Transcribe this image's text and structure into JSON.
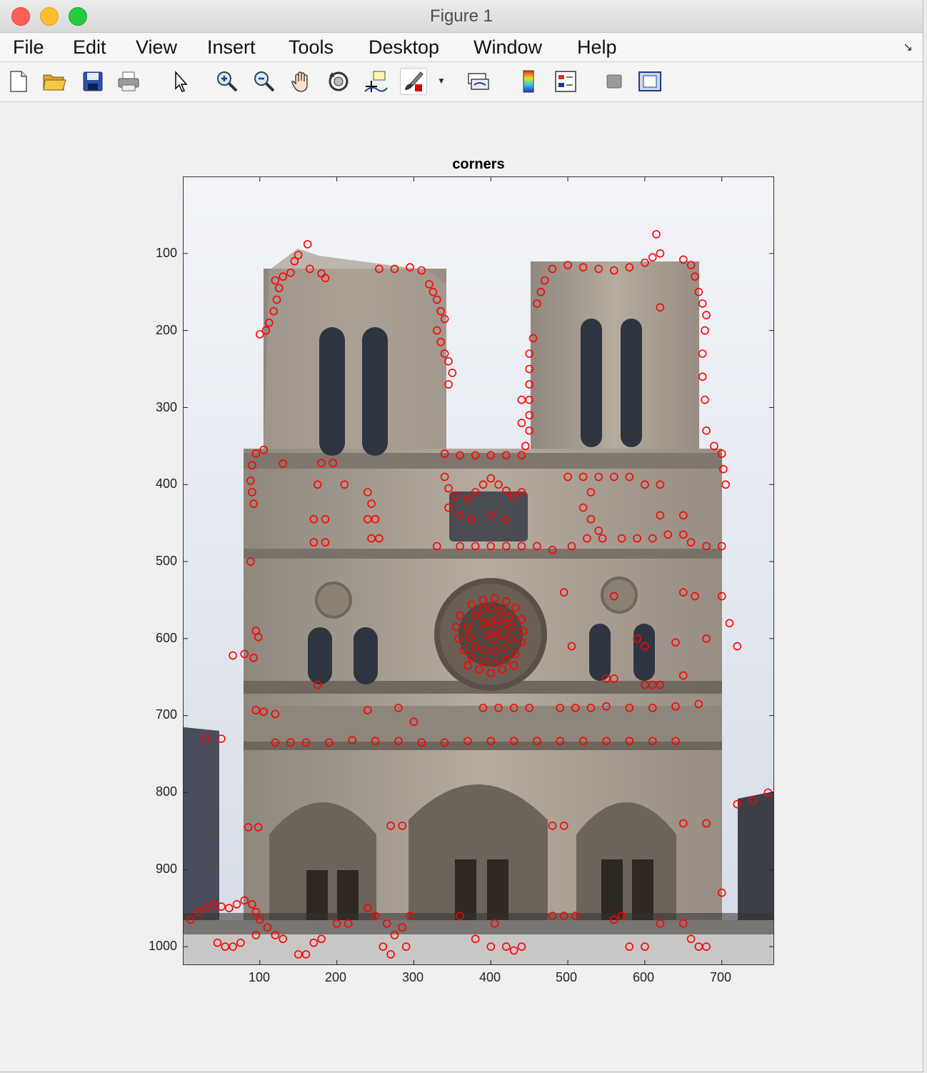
{
  "window": {
    "title": "Figure 1"
  },
  "menubar": {
    "items": [
      "File",
      "Edit",
      "View",
      "Insert",
      "Tools",
      "Desktop",
      "Window",
      "Help"
    ]
  },
  "toolbar": {
    "buttons": [
      "new-figure-icon",
      "open-file-icon",
      "save-icon",
      "print-icon",
      "pointer-icon",
      "zoom-in-icon",
      "zoom-out-icon",
      "pan-icon",
      "rotate-3d-icon",
      "data-cursor-icon",
      "brush-icon",
      "link-plot-icon",
      "colorbar-icon",
      "legend-icon",
      "hide-plot-tools-icon",
      "show-plot-tools-icon"
    ]
  },
  "colors": {
    "marker": "#ff0000",
    "sky": "#e4e8ee",
    "stone": "#a89e92"
  },
  "chart_data": {
    "type": "scatter",
    "title": "corners",
    "xlabel": "",
    "ylabel": "",
    "xlim": [
      0,
      768
    ],
    "ylim": [
      1024,
      0
    ],
    "y_reversed": true,
    "grid": false,
    "xticks": [
      "100",
      "200",
      "300",
      "400",
      "500",
      "600",
      "700"
    ],
    "yticks": [
      "100",
      "200",
      "300",
      "400",
      "500",
      "600",
      "700",
      "800",
      "900",
      "1000"
    ],
    "background": "photo of a cathedral facade with two towers",
    "marker": "circle",
    "points": [
      [
        162,
        88
      ],
      [
        150,
        102
      ],
      [
        145,
        110
      ],
      [
        165,
        120
      ],
      [
        180,
        126
      ],
      [
        185,
        132
      ],
      [
        125,
        145
      ],
      [
        122,
        160
      ],
      [
        118,
        175
      ],
      [
        112,
        190
      ],
      [
        108,
        200
      ],
      [
        100,
        205
      ],
      [
        120,
        135
      ],
      [
        130,
        130
      ],
      [
        140,
        125
      ],
      [
        255,
        120
      ],
      [
        275,
        120
      ],
      [
        295,
        118
      ],
      [
        310,
        122
      ],
      [
        320,
        140
      ],
      [
        325,
        150
      ],
      [
        330,
        160
      ],
      [
        335,
        175
      ],
      [
        340,
        185
      ],
      [
        330,
        200
      ],
      [
        335,
        215
      ],
      [
        340,
        230
      ],
      [
        345,
        240
      ],
      [
        350,
        255
      ],
      [
        345,
        270
      ],
      [
        455,
        210
      ],
      [
        450,
        230
      ],
      [
        450,
        250
      ],
      [
        450,
        270
      ],
      [
        450,
        290
      ],
      [
        450,
        310
      ],
      [
        450,
        330
      ],
      [
        445,
        350
      ],
      [
        440,
        320
      ],
      [
        440,
        290
      ],
      [
        460,
        165
      ],
      [
        465,
        150
      ],
      [
        470,
        135
      ],
      [
        480,
        120
      ],
      [
        500,
        115
      ],
      [
        520,
        118
      ],
      [
        540,
        120
      ],
      [
        560,
        122
      ],
      [
        580,
        118
      ],
      [
        600,
        112
      ],
      [
        610,
        105
      ],
      [
        620,
        100
      ],
      [
        650,
        108
      ],
      [
        660,
        115
      ],
      [
        665,
        130
      ],
      [
        670,
        150
      ],
      [
        675,
        165
      ],
      [
        680,
        180
      ],
      [
        678,
        200
      ],
      [
        675,
        230
      ],
      [
        620,
        170
      ],
      [
        615,
        75
      ],
      [
        675,
        260
      ],
      [
        678,
        290
      ],
      [
        680,
        330
      ],
      [
        690,
        350
      ],
      [
        700,
        360
      ],
      [
        702,
        380
      ],
      [
        705,
        400
      ],
      [
        340,
        360
      ],
      [
        360,
        362
      ],
      [
        380,
        362
      ],
      [
        400,
        362
      ],
      [
        420,
        362
      ],
      [
        440,
        362
      ],
      [
        340,
        390
      ],
      [
        345,
        405
      ],
      [
        355,
        415
      ],
      [
        370,
        420
      ],
      [
        380,
        410
      ],
      [
        390,
        400
      ],
      [
        400,
        392
      ],
      [
        410,
        400
      ],
      [
        420,
        408
      ],
      [
        430,
        415
      ],
      [
        440,
        410
      ],
      [
        345,
        430
      ],
      [
        360,
        440
      ],
      [
        375,
        445
      ],
      [
        400,
        440
      ],
      [
        420,
        445
      ],
      [
        105,
        355
      ],
      [
        95,
        360
      ],
      [
        90,
        375
      ],
      [
        88,
        395
      ],
      [
        90,
        410
      ],
      [
        92,
        425
      ],
      [
        130,
        373
      ],
      [
        195,
        372
      ],
      [
        180,
        372
      ],
      [
        175,
        400
      ],
      [
        210,
        400
      ],
      [
        240,
        410
      ],
      [
        245,
        425
      ],
      [
        240,
        445
      ],
      [
        250,
        445
      ],
      [
        245,
        470
      ],
      [
        255,
        470
      ],
      [
        170,
        445
      ],
      [
        185,
        445
      ],
      [
        170,
        475
      ],
      [
        185,
        475
      ],
      [
        330,
        480
      ],
      [
        360,
        480
      ],
      [
        380,
        480
      ],
      [
        400,
        480
      ],
      [
        420,
        480
      ],
      [
        440,
        480
      ],
      [
        460,
        480
      ],
      [
        480,
        485
      ],
      [
        505,
        480
      ],
      [
        500,
        390
      ],
      [
        520,
        390
      ],
      [
        540,
        390
      ],
      [
        560,
        390
      ],
      [
        580,
        390
      ],
      [
        600,
        400
      ],
      [
        620,
        400
      ],
      [
        530,
        410
      ],
      [
        520,
        430
      ],
      [
        530,
        445
      ],
      [
        540,
        460
      ],
      [
        525,
        470
      ],
      [
        545,
        470
      ],
      [
        570,
        470
      ],
      [
        590,
        470
      ],
      [
        610,
        470
      ],
      [
        630,
        465
      ],
      [
        650,
        465
      ],
      [
        660,
        475
      ],
      [
        650,
        440
      ],
      [
        620,
        440
      ],
      [
        680,
        480
      ],
      [
        700,
        480
      ],
      [
        650,
        540
      ],
      [
        665,
        545
      ],
      [
        700,
        545
      ],
      [
        710,
        580
      ],
      [
        720,
        610
      ],
      [
        680,
        600
      ],
      [
        640,
        605
      ],
      [
        600,
        610
      ],
      [
        590,
        600
      ],
      [
        505,
        610
      ],
      [
        495,
        540
      ],
      [
        560,
        545
      ],
      [
        88,
        500
      ],
      [
        95,
        590
      ],
      [
        98,
        598
      ],
      [
        80,
        620
      ],
      [
        92,
        625
      ],
      [
        65,
        622
      ],
      [
        175,
        660
      ],
      [
        360,
        570
      ],
      [
        355,
        585
      ],
      [
        358,
        600
      ],
      [
        365,
        615
      ],
      [
        375,
        625
      ],
      [
        390,
        630
      ],
      [
        405,
        632
      ],
      [
        420,
        628
      ],
      [
        432,
        620
      ],
      [
        440,
        605
      ],
      [
        442,
        590
      ],
      [
        440,
        575
      ],
      [
        432,
        560
      ],
      [
        420,
        552
      ],
      [
        405,
        548
      ],
      [
        390,
        550
      ],
      [
        375,
        556
      ],
      [
        370,
        585
      ],
      [
        372,
        598
      ],
      [
        380,
        610
      ],
      [
        392,
        615
      ],
      [
        405,
        616
      ],
      [
        418,
        612
      ],
      [
        426,
        600
      ],
      [
        428,
        585
      ],
      [
        424,
        572
      ],
      [
        414,
        564
      ],
      [
        402,
        560
      ],
      [
        390,
        562
      ],
      [
        380,
        570
      ],
      [
        390,
        580
      ],
      [
        395,
        595
      ],
      [
        405,
        600
      ],
      [
        415,
        595
      ],
      [
        418,
        582
      ],
      [
        408,
        575
      ],
      [
        398,
        578
      ],
      [
        405,
        588
      ],
      [
        385,
        640
      ],
      [
        400,
        645
      ],
      [
        415,
        640
      ],
      [
        370,
        635
      ],
      [
        430,
        635
      ],
      [
        95,
        693
      ],
      [
        105,
        695
      ],
      [
        120,
        698
      ],
      [
        240,
        693
      ],
      [
        280,
        690
      ],
      [
        300,
        708
      ],
      [
        390,
        690
      ],
      [
        410,
        690
      ],
      [
        430,
        690
      ],
      [
        450,
        690
      ],
      [
        490,
        690
      ],
      [
        510,
        690
      ],
      [
        530,
        690
      ],
      [
        550,
        688
      ],
      [
        580,
        690
      ],
      [
        610,
        690
      ],
      [
        640,
        688
      ],
      [
        670,
        685
      ],
      [
        120,
        735
      ],
      [
        140,
        735
      ],
      [
        160,
        735
      ],
      [
        190,
        735
      ],
      [
        220,
        732
      ],
      [
        250,
        733
      ],
      [
        280,
        733
      ],
      [
        310,
        735
      ],
      [
        340,
        735
      ],
      [
        370,
        733
      ],
      [
        400,
        733
      ],
      [
        430,
        733
      ],
      [
        460,
        733
      ],
      [
        490,
        733
      ],
      [
        520,
        733
      ],
      [
        550,
        733
      ],
      [
        580,
        733
      ],
      [
        610,
        733
      ],
      [
        640,
        733
      ],
      [
        30,
        730
      ],
      [
        50,
        730
      ],
      [
        550,
        652
      ],
      [
        560,
        652
      ],
      [
        600,
        660
      ],
      [
        610,
        660
      ],
      [
        620,
        660
      ],
      [
        650,
        648
      ],
      [
        85,
        845
      ],
      [
        98,
        845
      ],
      [
        270,
        843
      ],
      [
        285,
        843
      ],
      [
        480,
        843
      ],
      [
        495,
        843
      ],
      [
        650,
        840
      ],
      [
        680,
        840
      ],
      [
        720,
        815
      ],
      [
        740,
        810
      ],
      [
        760,
        800
      ],
      [
        700,
        930
      ],
      [
        10,
        965
      ],
      [
        20,
        955
      ],
      [
        30,
        950
      ],
      [
        40,
        945
      ],
      [
        50,
        948
      ],
      [
        60,
        950
      ],
      [
        70,
        945
      ],
      [
        80,
        940
      ],
      [
        90,
        945
      ],
      [
        95,
        955
      ],
      [
        100,
        965
      ],
      [
        110,
        975
      ],
      [
        120,
        985
      ],
      [
        130,
        990
      ],
      [
        150,
        1010
      ],
      [
        160,
        1010
      ],
      [
        170,
        995
      ],
      [
        180,
        990
      ],
      [
        45,
        995
      ],
      [
        55,
        1000
      ],
      [
        65,
        1000
      ],
      [
        75,
        995
      ],
      [
        95,
        985
      ],
      [
        200,
        970
      ],
      [
        215,
        970
      ],
      [
        240,
        950
      ],
      [
        250,
        960
      ],
      [
        265,
        970
      ],
      [
        275,
        985
      ],
      [
        285,
        975
      ],
      [
        295,
        960
      ],
      [
        260,
        1000
      ],
      [
        270,
        1010
      ],
      [
        290,
        1000
      ],
      [
        360,
        960
      ],
      [
        380,
        990
      ],
      [
        400,
        1000
      ],
      [
        405,
        970
      ],
      [
        420,
        1000
      ],
      [
        430,
        1005
      ],
      [
        440,
        1000
      ],
      [
        480,
        960
      ],
      [
        495,
        960
      ],
      [
        510,
        960
      ],
      [
        560,
        965
      ],
      [
        570,
        960
      ],
      [
        580,
        1000
      ],
      [
        600,
        1000
      ],
      [
        620,
        970
      ],
      [
        650,
        970
      ],
      [
        660,
        990
      ],
      [
        670,
        1000
      ],
      [
        680,
        1000
      ]
    ]
  }
}
